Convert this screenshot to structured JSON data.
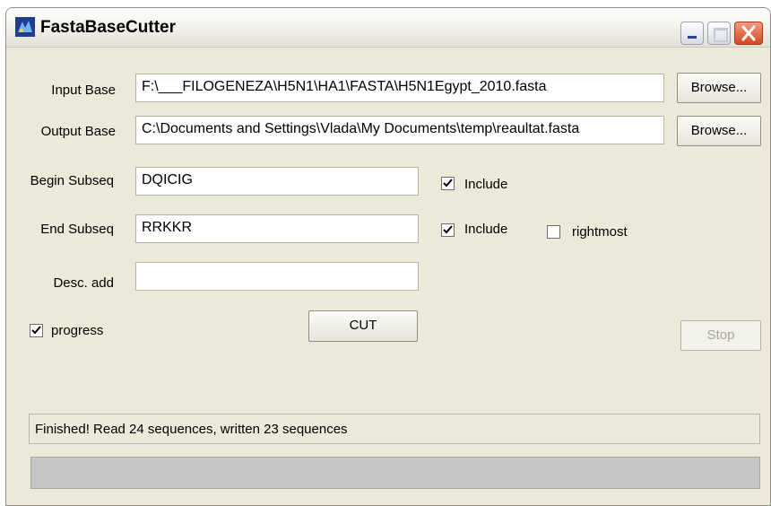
{
  "window": {
    "title": "FastaBaseCutter"
  },
  "inputs": {
    "input_base": {
      "label": "Input Base",
      "value": "F:\\___FILOGENEZA\\H5N1\\HA1\\FASTA\\H5N1Egypt_2010.fasta"
    },
    "output_base": {
      "label": "Output Base",
      "value": "C:\\Documents and Settings\\Vlada\\My Documents\\temp\\reaultat.fasta"
    },
    "begin_subseq": {
      "label": "Begin Subseq",
      "value": "DQICIG"
    },
    "end_subseq": {
      "label": "End Subseq",
      "value": "RRKKR"
    },
    "desc_add": {
      "label": "Desc. add",
      "value": ""
    }
  },
  "buttons": {
    "browse_input": "Browse...",
    "browse_output": "Browse...",
    "cut": "CUT",
    "stop": "Stop"
  },
  "checkboxes": {
    "begin_include": {
      "label": "Include",
      "checked": true
    },
    "end_include": {
      "label": "Include",
      "checked": true
    },
    "rightmost": {
      "label": "rightmost",
      "checked": false
    },
    "progress": {
      "label": "progress",
      "checked": true
    }
  },
  "status": {
    "text": "Finished! Read 24 sequences, written 23 sequences"
  },
  "progress": {
    "fraction": 0
  }
}
